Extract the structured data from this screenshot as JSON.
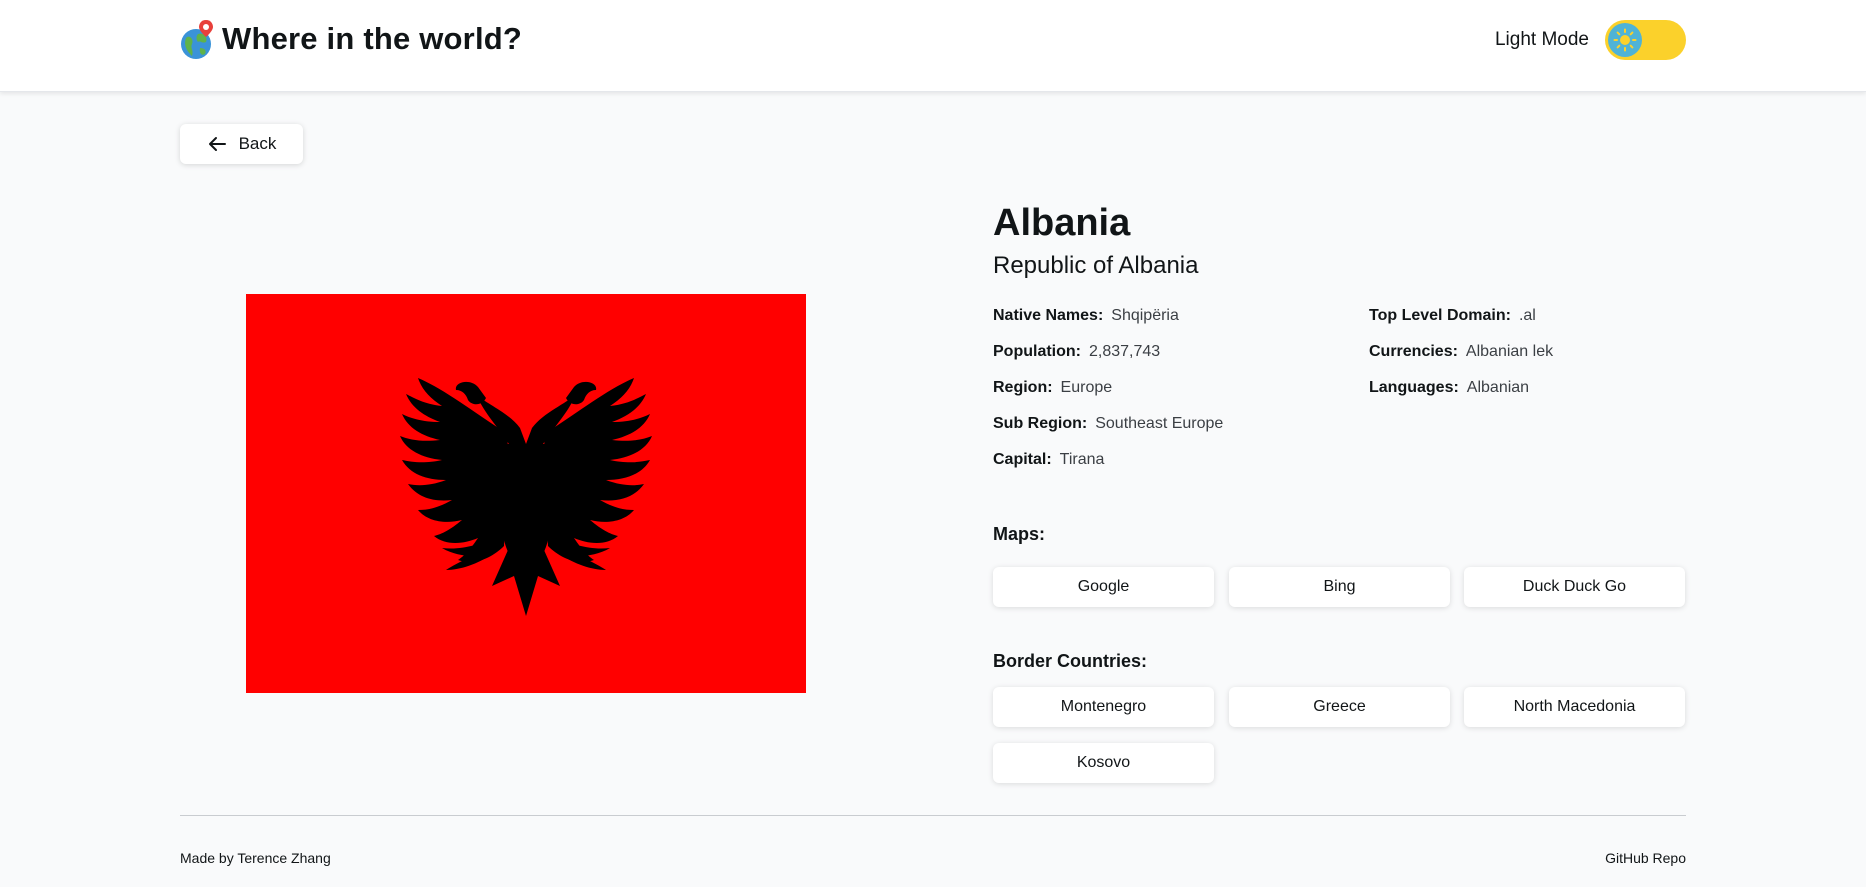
{
  "header": {
    "title": "Where in the world?",
    "mode_label": "Light Mode",
    "toggle_color": "#fbd12b",
    "knob_color": "#4fb3d6"
  },
  "back_button": {
    "label": "Back",
    "icon": "arrow-left-icon"
  },
  "country": {
    "name": "Albania",
    "official_name": "Republic of Albania",
    "flag": {
      "icon": "albania-flag",
      "background_color": "#ff0000",
      "eagle_color": "#000000"
    },
    "info_left": [
      {
        "key": "Native Names:",
        "value": "Shqipëria"
      },
      {
        "key": "Population:",
        "value": "2,837,743"
      },
      {
        "key": "Region:",
        "value": "Europe"
      },
      {
        "key": "Sub Region:",
        "value": "Southeast Europe"
      },
      {
        "key": "Capital:",
        "value": "Tirana"
      }
    ],
    "info_right": [
      {
        "key": "Top Level Domain:",
        "value": ".al"
      },
      {
        "key": "Currencies:",
        "value": "Albanian lek"
      },
      {
        "key": "Languages:",
        "value": "Albanian"
      }
    ]
  },
  "maps": {
    "title": "Maps:",
    "links": [
      "Google",
      "Bing",
      "Duck Duck Go"
    ]
  },
  "borders": {
    "title": "Border Countries:",
    "countries": [
      "Montenegro",
      "Greece",
      "North Macedonia",
      "Kosovo"
    ]
  },
  "footer": {
    "credit": "Made by Terence Zhang",
    "repo_link": "GitHub Repo"
  }
}
